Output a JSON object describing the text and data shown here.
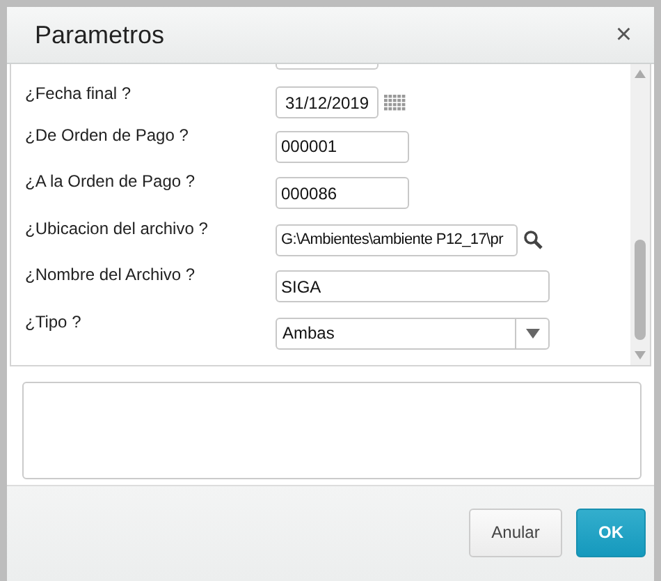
{
  "dialog": {
    "title": "Parametros",
    "close": "×"
  },
  "fields": [
    {
      "label": "¿Fecha final ?",
      "kind": "date",
      "value": "31/12/2019"
    },
    {
      "label": "¿De Orden de Pago ?",
      "kind": "text",
      "value": "000001"
    },
    {
      "label": "¿A la Orden de Pago ?",
      "kind": "text",
      "value": "000086"
    },
    {
      "label": "¿Ubicacion del archivo ?",
      "kind": "browse",
      "value": "G:\\Ambientes\\ambiente P12_17\\pr"
    },
    {
      "label": "¿Nombre del Archivo ?",
      "kind": "wide",
      "value": "SIGA"
    },
    {
      "label": "¿Tipo ?",
      "kind": "select",
      "value": "Ambas"
    }
  ],
  "buttons": [
    {
      "label": "Anular",
      "kind": "secondary"
    },
    {
      "label": "OK",
      "kind": "primary"
    }
  ]
}
